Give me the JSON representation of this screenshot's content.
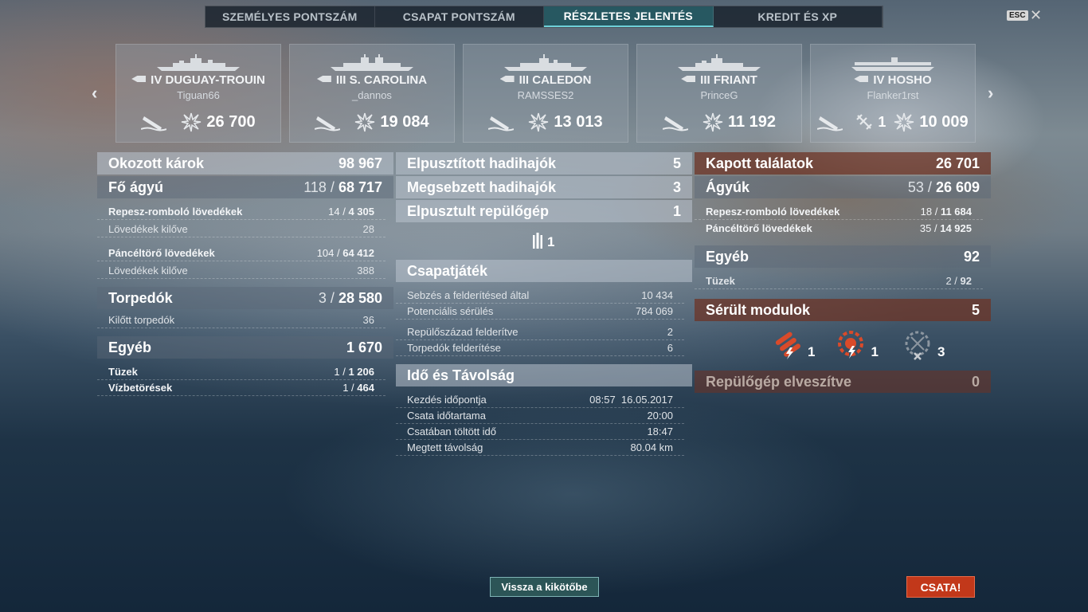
{
  "tabs": [
    {
      "label": "SZEMÉLYES PONTSZÁM"
    },
    {
      "label": "CSAPAT PONTSZÁM"
    },
    {
      "label": "RÉSZLETES JELENTÉS"
    },
    {
      "label": "KREDIT ÉS XP"
    }
  ],
  "esc": "ESC",
  "close": "✕",
  "nav": {
    "prev": "‹",
    "next": "›"
  },
  "ships": [
    {
      "name": "IV DUGUAY-TROUIN",
      "player": "Tiguan66",
      "damage": "26 700"
    },
    {
      "name": "III S. CAROLINA",
      "player": "_dannos",
      "damage": "19 084"
    },
    {
      "name": "III CALEDON",
      "player": "RAMSSES2",
      "damage": "13 013"
    },
    {
      "name": "III FRIANT",
      "player": "PrinceG",
      "damage": "11 192"
    },
    {
      "name": "IV HOSHO",
      "player": "Flanker1rst",
      "planes": "1",
      "damage": "10 009"
    }
  ],
  "left": {
    "total": {
      "label": "Okozott károk",
      "value": "98 967"
    },
    "main": {
      "label": "Fő ágyú",
      "hits": "118 /",
      "dmg": "68 717"
    },
    "he": {
      "label": "Repesz-romboló lövedékek",
      "hits": "14 /",
      "dmg": "4 305"
    },
    "he_fired": {
      "label": "Lövedékek kilőve",
      "value": "28"
    },
    "ap": {
      "label": "Páncéltörő lövedékek",
      "hits": "104 /",
      "dmg": "64 412"
    },
    "ap_fired": {
      "label": "Lövedékek kilőve",
      "value": "388"
    },
    "torp": {
      "label": "Torpedók",
      "hits": "3 /",
      "dmg": "28 580"
    },
    "torp_fired": {
      "label": "Kilőtt torpedók",
      "value": "36"
    },
    "other": {
      "label": "Egyéb",
      "value": "1 670"
    },
    "fires": {
      "label": "Tüzek",
      "hits": "1 /",
      "dmg": "1 206"
    },
    "floods": {
      "label": "Vízbetörések",
      "hits": "1 /",
      "dmg": "464"
    }
  },
  "mid": {
    "destroyed": {
      "label": "Elpusztított hadihajók",
      "value": "5"
    },
    "damaged": {
      "label": "Megsebzett hadihajók",
      "value": "3"
    },
    "planes": {
      "label": "Elpusztult repülőgép",
      "value": "1"
    },
    "plane_icon_count": "1",
    "team": {
      "label": "Csapatjáték"
    },
    "spot_dmg": {
      "label": "Sebzés a felderítésed által",
      "value": "10 434"
    },
    "potential": {
      "label": "Potenciális sérülés",
      "value": "784 069"
    },
    "squad_spotted": {
      "label": "Repülőszázad felderítve",
      "value": "2"
    },
    "torp_spotted": {
      "label": "Torpedók felderítése",
      "value": "6"
    },
    "time": {
      "label": "Idő és Távolság"
    },
    "start": {
      "label": "Kezdés időpontja",
      "value": "08:57  16.05.2017"
    },
    "duration": {
      "label": "Csata időtartama",
      "value": "20:00"
    },
    "time_in": {
      "label": "Csatában töltött idő",
      "value": "18:47"
    },
    "distance": {
      "label": "Megtett távolság",
      "value": "80.04 km"
    }
  },
  "right": {
    "received": {
      "label": "Kapott találatok",
      "value": "26 701"
    },
    "guns": {
      "label": "Ágyúk",
      "hits": "53 /",
      "dmg": "26 609"
    },
    "he": {
      "label": "Repesz-romboló lövedékek",
      "hits": "18 /",
      "dmg": "11 684"
    },
    "ap": {
      "label": "Páncéltörő lövedékek",
      "hits": "35 /",
      "dmg": "14 925"
    },
    "other": {
      "label": "Egyéb",
      "value": "92"
    },
    "fires": {
      "label": "Tüzek",
      "hits": "2 /",
      "dmg": "92"
    },
    "modules": {
      "label": "Sérült modulok",
      "value": "5"
    },
    "mod_torp": "1",
    "mod_engine": "1",
    "mod_aa": "3",
    "planes_lost": {
      "label": "Repülőgép elveszítve",
      "value": "0"
    }
  },
  "buttons": {
    "back": "Vissza a kikötőbe",
    "battle": "CSATA!"
  }
}
